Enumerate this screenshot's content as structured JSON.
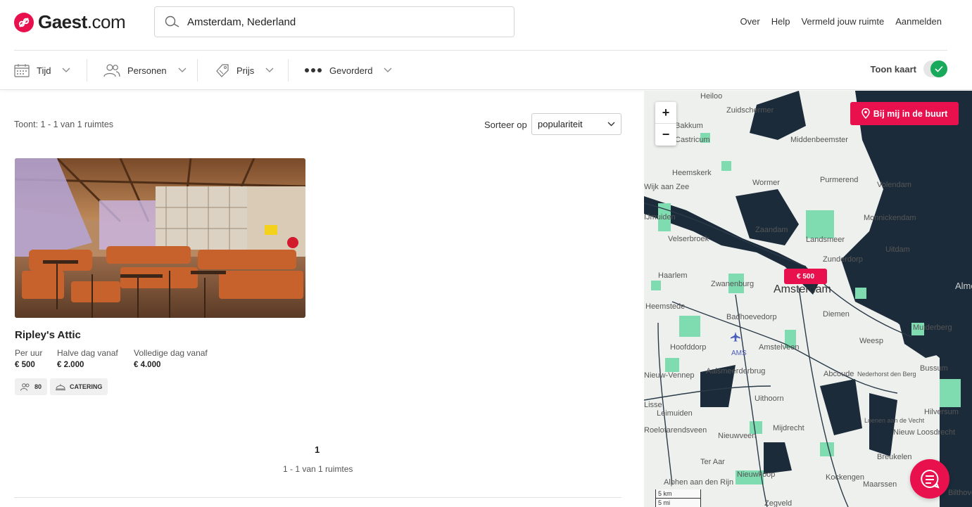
{
  "header": {
    "logo_prefix": "Gaest",
    "logo_suffix": ".com",
    "search_value": "Amsterdam, Nederland",
    "nav": [
      "Over",
      "Help",
      "Vermeld jouw ruimte",
      "Aanmelden"
    ]
  },
  "filters": {
    "time": "Tijd",
    "persons": "Personen",
    "price": "Prijs",
    "advanced": "Gevorderd",
    "show_map": "Toon kaart",
    "show_map_enabled": true
  },
  "results": {
    "count_text": "Toont: 1 - 1 van 1 ruimtes",
    "sort_label": "Sorteer op",
    "sort_value": "populariteit"
  },
  "listing": {
    "title": "Ripley's Attic",
    "prices": [
      {
        "label": "Per uur",
        "value": "€ 500"
      },
      {
        "label": "Halve dag vanaf",
        "value": "€ 2.000"
      },
      {
        "label": "Volledige dag vanaf",
        "value": "€ 4.000"
      }
    ],
    "capacity": "80",
    "tag": "CATERING"
  },
  "pagination": {
    "current": "1",
    "info": "1 - 1 van 1 ruimtes"
  },
  "map": {
    "zoom_in": "+",
    "zoom_out": "−",
    "nearby_button": "Bij mij in de buurt",
    "marker_price": "€ 500",
    "scale_km": "5 km",
    "scale_mi": "5 mi",
    "places": [
      "Heiloo",
      "Zuidschermer",
      "Bakkum",
      "Castricum",
      "Middenbeemster",
      "Heemskerk",
      "Wormer",
      "Purmerend",
      "Volendam",
      "Wijk aan Zee",
      "IJmuiden",
      "Zaandam",
      "Monnickendam",
      "Velserbroek",
      "Landsmeer",
      "Uitdam",
      "Haarlem",
      "Zwanenburg",
      "Zunderdorp",
      "Amsterdam",
      "Heemstede",
      "Badhoevedorp",
      "Diemen",
      "Muiderberg",
      "Hoofddorp",
      "AMS",
      "Amstelveen",
      "Weesp",
      "Nieuw-Vennep",
      "Aalsmeerderbrug",
      "Abcoude",
      "Nederhorst den Berg",
      "Bussum",
      "Lisse",
      "Uithoorn",
      "Leimuiden",
      "Loenen aan de Vecht",
      "Hilversum",
      "Roelofarendsveen",
      "Mijdrecht",
      "Nieuw Loosdrecht",
      "Nieuwveen",
      "Breukelen",
      "Ter Aar",
      "Nieuwkoop",
      "Kockengen",
      "Alphen aan den Rijn",
      "Maarssen",
      "Bilthoven",
      "Zegveld",
      "Almere"
    ],
    "colors": {
      "water": "#1b2b3a",
      "land": "#eef0ee",
      "green": "#7fdcb0",
      "accent": "#e8114d"
    }
  }
}
